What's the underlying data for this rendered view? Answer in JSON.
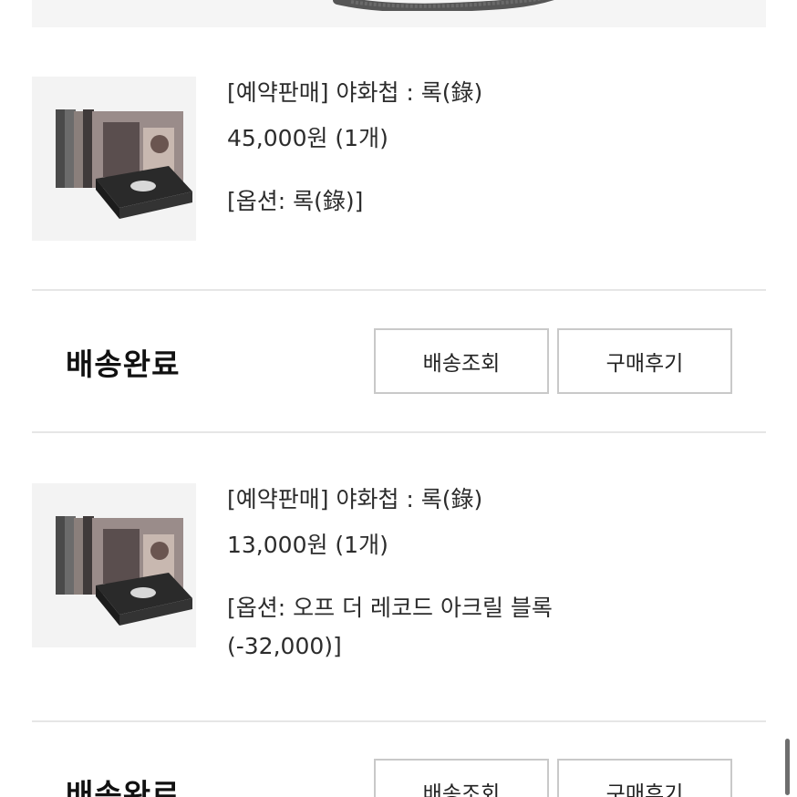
{
  "orders": [
    {
      "title": "[예약판매] 야화첩 : 록(錄)",
      "price": "45,000원 (1개)",
      "option_line1": "[옵션: 록(錄)]",
      "option_line2": "",
      "status": "배송완료",
      "track_button": "배송조회",
      "review_button": "구매후기",
      "thumbnail": "product-box-image"
    },
    {
      "title": "[예약판매] 야화첩 : 록(錄)",
      "price": "13,000원 (1개)",
      "option_line1": "[옵션: 오프 더 레코드 아크릴 블록",
      "option_line2": "(-32,000)]",
      "status": "배송완료",
      "track_button": "배송조회",
      "review_button": "구매후기",
      "thumbnail": "product-box-image"
    }
  ],
  "colors": {
    "text": "#2c2c2c",
    "status_text": "#111111",
    "button_border": "#c9c9c9",
    "divider": "#e6e6e6"
  }
}
